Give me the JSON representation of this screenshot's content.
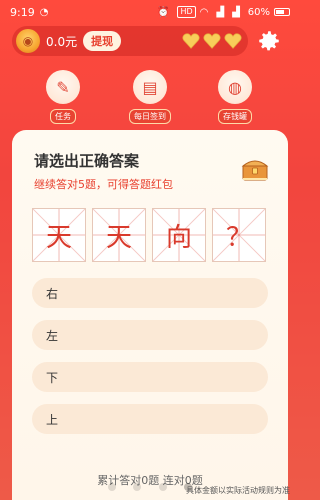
{
  "status": {
    "time": "9:19",
    "battery_text": "60%",
    "hd": "HD"
  },
  "header": {
    "balance": "0.0元",
    "withdraw_label": "提现",
    "hearts": 3,
    "heart_color": "#f8cd5a"
  },
  "shortcuts": [
    {
      "label": "任务",
      "icon": "task-icon"
    },
    {
      "label": "每日签到",
      "icon": "checkin-icon"
    },
    {
      "label": "存钱罐",
      "icon": "piggy-bank-icon"
    }
  ],
  "question": {
    "title": "请选出正确答案",
    "subtitle": "继续答对5题，可得答题红包",
    "chars": [
      "天",
      "天",
      "向",
      "？"
    ]
  },
  "options": [
    "右",
    "左",
    "下",
    "上"
  ],
  "stats": "累计答对0题  连对0题",
  "footer_note": "具体金额以实际活动规则为准",
  "colors": {
    "accent": "#e8412f",
    "card_bg": "#fff8ee",
    "option_bg": "#fbe9d6"
  }
}
